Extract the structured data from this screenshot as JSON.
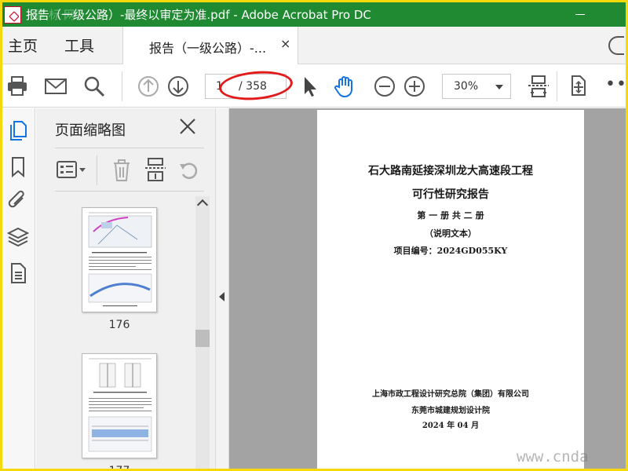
{
  "window": {
    "title": "报告（一级公路）-最终以审定为准.pdf - Adobe Acrobat Pro DC",
    "watermark_top": "建标网"
  },
  "menu": {
    "home": "主页",
    "tools": "工具",
    "tab_label": "报告（一级公路）-...",
    "tab_close": "×"
  },
  "toolbar": {
    "page_current": "1",
    "page_total": "/ 358",
    "zoom": "30%",
    "more": "•••"
  },
  "thumbnail_panel": {
    "title": "页面缩略图",
    "thumbnails": [
      {
        "page_label": "176"
      },
      {
        "page_label": "177"
      }
    ]
  },
  "document": {
    "title_line1": "石大路南延接深圳龙大高速段工程",
    "title_line2": "可行性研究报告",
    "volume": "第 一 册  共 二 册",
    "description": "（说明文本）",
    "project_no": "项目编号：2024GD055KY",
    "org1": "上海市政工程设计研究总院（集团）有限公司",
    "org2": "东莞市城建规划设计院",
    "date": "2024 年 04 月"
  },
  "watermark_bottom": "www.cnda",
  "colors": {
    "titlebar": "#1f8a32",
    "frame": "#f5d90a",
    "accent_blue": "#1473e6",
    "highlight_red": "#e31a1a"
  }
}
